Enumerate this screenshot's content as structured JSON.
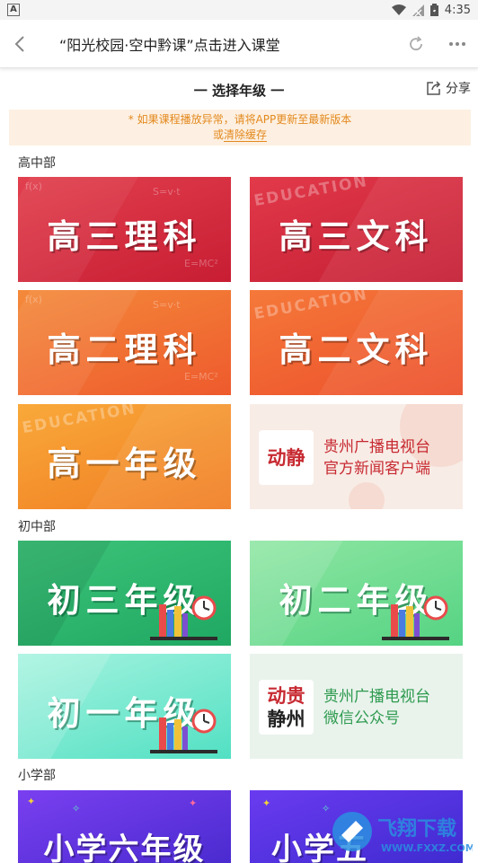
{
  "status_bar": {
    "left_icon": "A",
    "time": "4:35"
  },
  "top_bar": {
    "title": "“阳光校园·空中黔课”点击进入课堂"
  },
  "section": {
    "title": "一 选择年级 一",
    "share_label": "分享"
  },
  "notice": {
    "line1": "* 如果课程播放异常，请将APP更新至最新版本",
    "line2_prefix": "或",
    "line2_link": "清除缓存"
  },
  "groups": {
    "high": "高中部",
    "junior": "初中部",
    "primary": "小学部"
  },
  "tiles": {
    "g3_sci": "高三理科",
    "g3_art": "高三文科",
    "g2_sci": "高二理科",
    "g2_art": "高二文科",
    "g1": "高一年级",
    "j3": "初三年级",
    "j2": "初二年级",
    "j1": "初一年级",
    "p6": "小学六年级",
    "p5": "小学五"
  },
  "ads": {
    "app_logo_line1": "动静",
    "app_line1": "贵州广播电视台",
    "app_line2": "官方新闻客户端",
    "wechat_logo_line1": "动贵",
    "wechat_logo_line2": "静州",
    "wechat_line1": "贵州广播电视台",
    "wechat_line2": "微信公众号"
  },
  "decor": {
    "education": "EDUCATION",
    "formula1": "E=MC²",
    "formula2": "S=v·t",
    "formula3": "f(x)"
  },
  "watermark": {
    "text": "飞翔下载",
    "url": "WWW.FXXZ.COM"
  },
  "colors": {
    "red": "#d6243a",
    "orange": "#f0682f",
    "green": "#27b76f",
    "mint": "#5fe3c6",
    "purple": "#5b2fd8",
    "notice": "#e3891d"
  }
}
